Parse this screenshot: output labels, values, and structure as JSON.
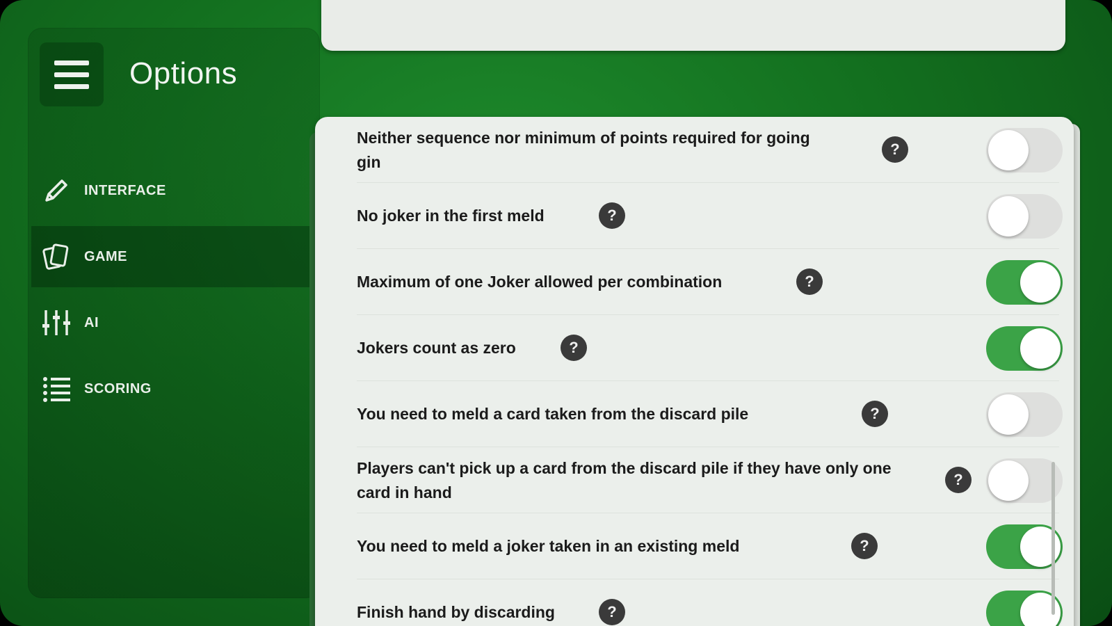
{
  "header": {
    "title": "Options",
    "menu_icon": "hamburger-menu-icon"
  },
  "sidebar": {
    "items": [
      {
        "label": "INTERFACE",
        "icon": "pencil-icon",
        "active": false
      },
      {
        "label": "GAME",
        "icon": "cards-icon",
        "active": true
      },
      {
        "label": "AI",
        "icon": "sliders-icon",
        "active": false
      },
      {
        "label": "SCORING",
        "icon": "list-icon",
        "active": false
      }
    ]
  },
  "settings": {
    "help_glyph": "?",
    "items": [
      {
        "label": "Neither sequence nor minimum of points required for going gin",
        "enabled": false
      },
      {
        "label": "No joker in the first meld",
        "enabled": false
      },
      {
        "label": "Maximum of one Joker allowed per combination",
        "enabled": true
      },
      {
        "label": "Jokers count as zero",
        "enabled": true
      },
      {
        "label": "You need to meld a card taken from the discard pile",
        "enabled": false
      },
      {
        "label": "Players can't pick up a card from the discard pile if they have only one card in hand",
        "enabled": false
      },
      {
        "label": "You need to meld a joker taken in an existing meld",
        "enabled": true
      },
      {
        "label": "Finish hand by discarding",
        "enabled": true
      }
    ]
  },
  "colors": {
    "background_green": "#13701f",
    "toggle_on": "#3ba347",
    "toggle_off": "#dedfdd",
    "card_bg": "#ebefeb"
  }
}
